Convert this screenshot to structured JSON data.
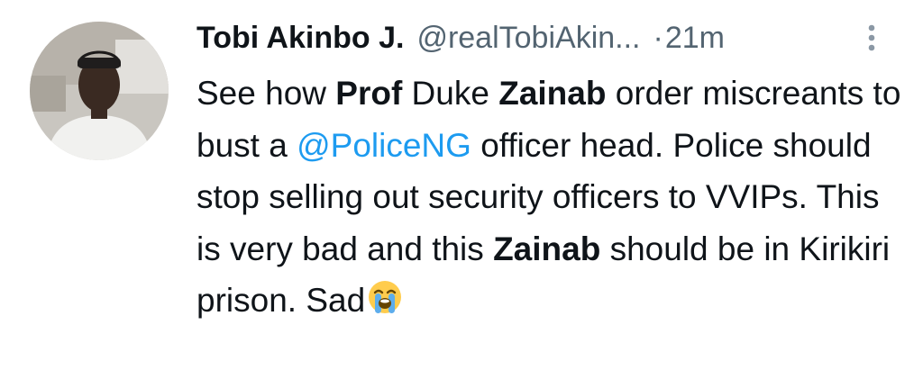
{
  "tweet": {
    "display_name": "Tobi Akinbo J.",
    "handle": "@realTobiAkin...",
    "separator": "·",
    "timestamp": "21m",
    "more_icon": "more-vertical-icon",
    "body": {
      "t1": "See how ",
      "b1": "Prof",
      "t2": " Duke ",
      "b2": "Zainab",
      "t3": " order miscreants to bust a ",
      "mention": "@PoliceNG",
      "t4": " officer head. Police should stop selling out security officers to VVIPs. This is very bad and this ",
      "b3": "Zainab",
      "t5": " should be in Kirikiri prison. Sad",
      "emoji": "loudly-crying-face-emoji"
    }
  },
  "colors": {
    "text": "#0f1419",
    "secondary": "#536471",
    "link": "#1d9bf0"
  }
}
